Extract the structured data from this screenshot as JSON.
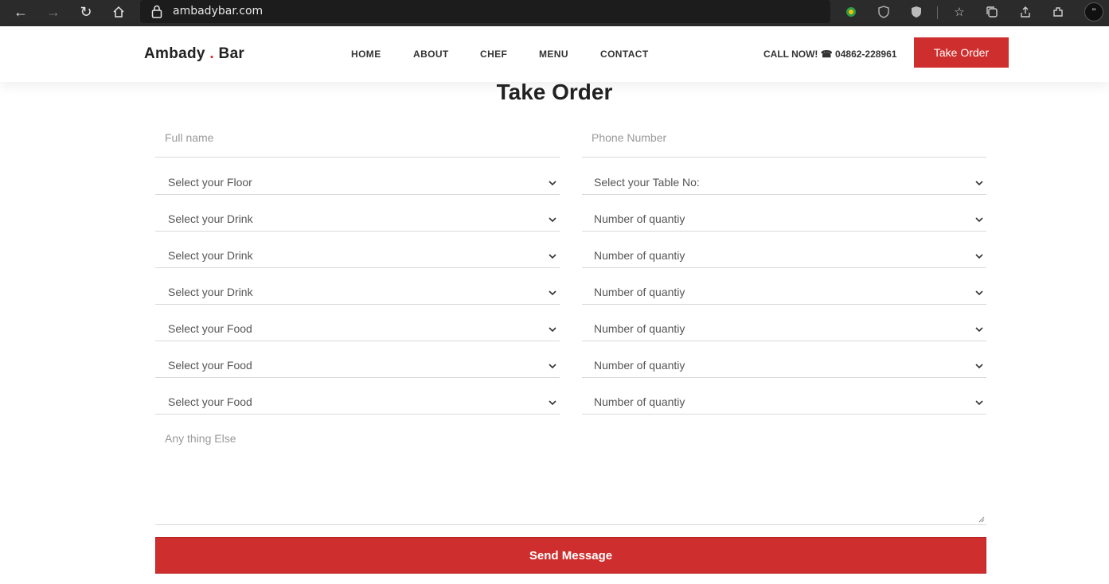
{
  "browser": {
    "url": "ambadybar.com",
    "profile_initial": "’’"
  },
  "header": {
    "logo_part1": "Ambady",
    "logo_dot": ".",
    "logo_part2": "Bar",
    "nav": [
      "HOME",
      "ABOUT",
      "CHEF",
      "MENU",
      "CONTACT"
    ],
    "call_label": "CALL NOW! ☎ 04862-228961",
    "cta_label": "Take Order"
  },
  "form": {
    "title": "Take Order",
    "full_name_placeholder": "Full name",
    "phone_placeholder": "Phone Number",
    "floor_select": "Select your Floor",
    "table_select": "Select your Table No:",
    "rows": [
      {
        "left": "Select your Drink",
        "right": "Number of quantiy"
      },
      {
        "left": "Select your Drink",
        "right": "Number of quantiy"
      },
      {
        "left": "Select your Drink",
        "right": "Number of quantiy"
      },
      {
        "left": "Select your Food",
        "right": "Number of quantiy"
      },
      {
        "left": "Select your Food",
        "right": "Number of quantiy"
      },
      {
        "left": "Select your Food",
        "right": "Number of quantiy"
      }
    ],
    "message_placeholder": "Any thing Else",
    "submit_label": "Send Message"
  },
  "colors": {
    "accent": "#cf2e2e",
    "chrome_bg": "#2b2b2b"
  }
}
